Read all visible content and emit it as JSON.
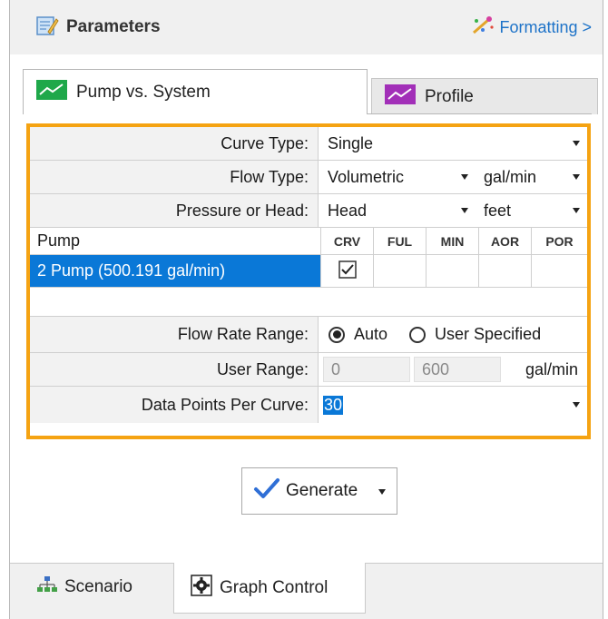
{
  "header": {
    "title": "Parameters",
    "formatting_label": "Formatting >"
  },
  "tabs": [
    {
      "label": "Pump vs. System",
      "active": true
    },
    {
      "label": "Profile",
      "active": false
    }
  ],
  "form": {
    "curve_type": {
      "label": "Curve Type:",
      "value": "Single"
    },
    "flow_type": {
      "label": "Flow Type:",
      "value": "Volumetric",
      "unit": "gal/min"
    },
    "pressure_or_head": {
      "label": "Pressure or Head:",
      "value": "Head",
      "unit": "feet"
    }
  },
  "pump_grid": {
    "columns": [
      "Pump",
      "CRV",
      "FUL",
      "MIN",
      "AOR",
      "POR"
    ],
    "rows": [
      {
        "name": "2  Pump  (500.191 gal/min)",
        "crv": true,
        "ful": false,
        "min": false,
        "aor": false,
        "por": false
      }
    ]
  },
  "flow_rate_range": {
    "label": "Flow Rate Range:",
    "options": [
      "Auto",
      "User Specified"
    ],
    "selected": "Auto"
  },
  "user_range": {
    "label": "User Range:",
    "min": "0",
    "max": "600",
    "unit": "gal/min"
  },
  "data_points": {
    "label": "Data Points Per Curve:",
    "value": "30"
  },
  "generate_label": "Generate",
  "bottom_tabs": [
    {
      "label": "Scenario",
      "active": false
    },
    {
      "label": "Graph Control",
      "active": true
    }
  ],
  "colors": {
    "accent_orange": "#f5a312",
    "selection_blue": "#0a78d7",
    "link_blue": "#1e73c8"
  }
}
